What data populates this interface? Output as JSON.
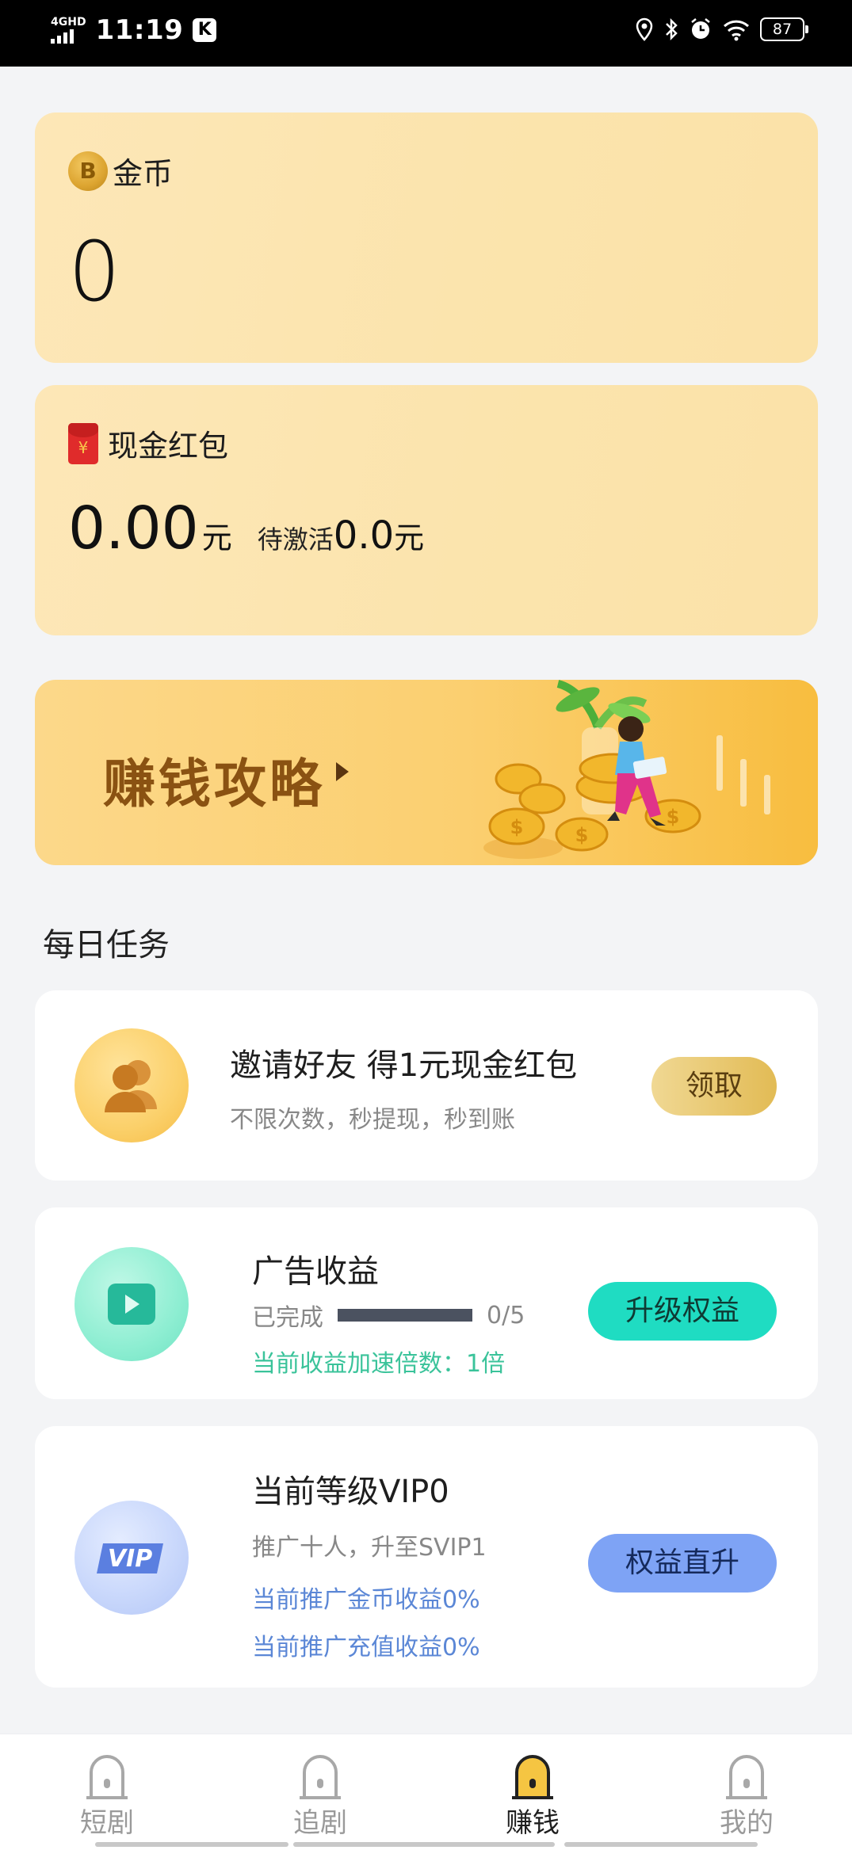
{
  "status_bar": {
    "network": "4GHD",
    "time": "11:19",
    "app_badge": "K",
    "battery": "87",
    "icons": [
      "location-icon",
      "bluetooth-icon",
      "alarm-icon",
      "wifi-icon"
    ]
  },
  "coin_card": {
    "label": "金币",
    "icon": "coin-icon",
    "icon_letter": "B",
    "value": "0"
  },
  "cash_card": {
    "label": "现金红包",
    "icon": "red-packet-icon",
    "icon_symbol": "¥",
    "value": "0.00",
    "unit": "元",
    "pending_label": "待激活",
    "pending_value": "0.0",
    "pending_unit": "元"
  },
  "banner": {
    "title": "赚钱攻略"
  },
  "daily_tasks": {
    "section_title": "每日任务",
    "invite": {
      "title": "邀请好友 得1元现金红包",
      "subtitle": "不限次数，秒提现，秒到账",
      "button": "领取"
    },
    "ads": {
      "title": "广告收益",
      "done_label": "已完成",
      "progress_current": 0,
      "progress_total": 5,
      "progress_text": "0/5",
      "boost_text": "当前收益加速倍数：1倍",
      "button": "升级权益"
    },
    "vip": {
      "title": "当前等级VIP0",
      "subtitle": "推广十人，升至SVIP1",
      "line1": "当前推广金币收益0%",
      "line2": "当前推广充值收益0%",
      "badge": "VIP",
      "button": "权益直升"
    }
  },
  "bottom_nav": {
    "items": [
      {
        "label": "短剧",
        "active": false
      },
      {
        "label": "追剧",
        "active": false
      },
      {
        "label": "赚钱",
        "active": true
      },
      {
        "label": "我的",
        "active": false
      }
    ]
  },
  "colors": {
    "gold_card": "#fbe4ad",
    "accent_teal": "#1fdcc2",
    "accent_blue": "#7ea3f5",
    "boost_green": "#3ac39a",
    "vip_blue_text": "#5b87d6",
    "active_nav": "#f5c542"
  }
}
